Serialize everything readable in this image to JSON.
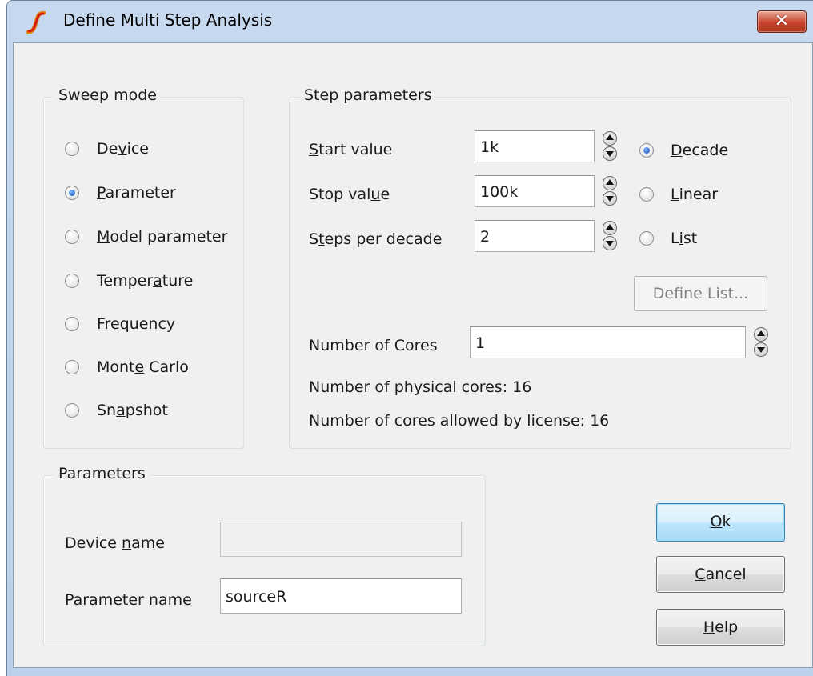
{
  "window": {
    "title": "Define Multi Step Analysis",
    "close_symbol": "✕",
    "app_icon": "simetrix-logo-icon"
  },
  "sweep_mode": {
    "title": "Sweep mode",
    "options": [
      {
        "label": "Device",
        "checked": false
      },
      {
        "label": "Parameter",
        "checked": true
      },
      {
        "label": "Model parameter",
        "checked": false
      },
      {
        "label": "Temperature",
        "checked": false
      },
      {
        "label": "Frequency",
        "checked": false
      },
      {
        "label": "Monte Carlo",
        "checked": false
      },
      {
        "label": "Snapshot",
        "checked": false
      }
    ]
  },
  "step_parameters": {
    "title": "Step parameters",
    "start_label": "Start value",
    "start_value": "1k",
    "stop_label": "Stop value",
    "stop_value": "100k",
    "steps_label": "Steps per decade",
    "steps_value": "2",
    "scale_options": [
      {
        "label": "Decade",
        "checked": true
      },
      {
        "label": "Linear",
        "checked": false
      },
      {
        "label": "List",
        "checked": false
      }
    ],
    "define_list_label": "Define List...",
    "cores_label": "Number of Cores",
    "cores_value": "1",
    "physical_cores_text": "Number of physical cores: 16",
    "license_cores_text": "Number of cores allowed by license: 16"
  },
  "parameters": {
    "title": "Parameters",
    "device_name_label": "Device name",
    "device_name_value": "",
    "parameter_name_label": "Parameter name",
    "parameter_name_value": "sourceR"
  },
  "buttons": {
    "ok": "Ok",
    "cancel": "Cancel",
    "help": "Help"
  },
  "colors": {
    "window_frame": "#c6d9ef",
    "client_bg": "#f0f0f0",
    "close_button": "#c8442d",
    "default_button_border": "#3c7fb1"
  }
}
